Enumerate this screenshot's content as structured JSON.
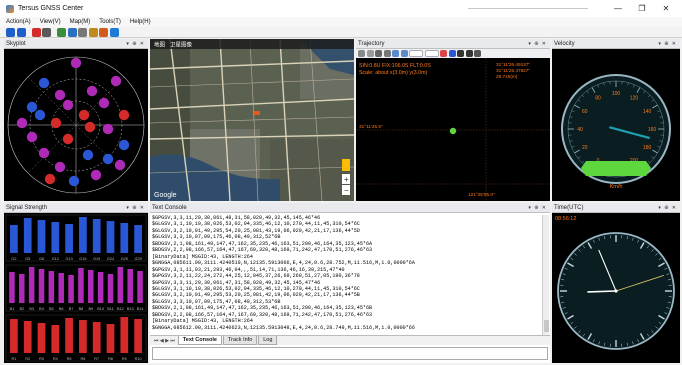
{
  "window": {
    "title": "Tersus GNSS Center",
    "controls": {
      "minimize": "—",
      "maximize": "❐",
      "close": "✕"
    }
  },
  "menu": [
    {
      "label": "Action(A)"
    },
    {
      "label": "View(V)"
    },
    {
      "label": "Map(M)"
    },
    {
      "label": "Tools(T)"
    },
    {
      "label": "Help(H)"
    }
  ],
  "toolbar_icons": [
    {
      "name": "connect-icon",
      "color": "#1f5fc9"
    },
    {
      "name": "disconnect-icon",
      "color": "#1f5fc9"
    },
    {
      "name": "record-icon",
      "color": "#d42a2a"
    },
    {
      "name": "stop-icon",
      "color": "#5a5a5a"
    },
    {
      "name": "open-file-icon",
      "color": "#3a8d3a"
    },
    {
      "name": "save-icon",
      "color": "#2a6fc0"
    },
    {
      "name": "settings-icon",
      "color": "#777777"
    },
    {
      "name": "config-icon",
      "color": "#c08a1e"
    },
    {
      "name": "upgrade-icon",
      "color": "#d45a1e"
    },
    {
      "name": "help-icon",
      "color": "#1e7ad4"
    }
  ],
  "panels": {
    "skyplot": {
      "title": "Skyplot",
      "controls": "▾ ⊕ ✕"
    },
    "map": {
      "tabs": [
        "地图",
        "卫星图像"
      ],
      "google_label": "Google",
      "zoom_in": "+",
      "zoom_out": "−"
    },
    "trajectory": {
      "title": "Trajectory",
      "controls": "▾ ⊕ ✕",
      "status_line1": "SIN:0.8U FIX:106.0S FLT:0.0S",
      "status_line2": "Scale: about x(3.0m) y(3.0m)",
      "coord_top1": "31°11'26.49137\"",
      "coord_top2": "31°11'26.47827\"",
      "coord_top3": "28.745(m)",
      "coord_left": "31°11'26.5\"",
      "coord_bottom": "121°25'05.0\""
    },
    "velocity": {
      "title": "Velocity",
      "controls": "▾ ⊕ ✕",
      "ticks": [
        "0",
        "20",
        "40",
        "60",
        "80",
        "100",
        "120",
        "140",
        "160",
        "180",
        "200"
      ],
      "display_value": "",
      "unit_label": "Km/h"
    },
    "signal": {
      "title": "Signal Strength",
      "controls": "▾ ⊕ ✕",
      "groups": [
        {
          "system": "GPS",
          "color": "#2a57d6",
          "labels": [
            "G2",
            "G5",
            "G6",
            "G12",
            "G13",
            "G15",
            "G19",
            "G24",
            "G25",
            "G29"
          ]
        },
        {
          "system": "BDS",
          "color": "#b02ab8",
          "labels": [
            "B1",
            "B2",
            "B3",
            "B4",
            "B5",
            "B6",
            "B7",
            "B8",
            "B9",
            "B10",
            "B11",
            "B12",
            "B13",
            "B14"
          ]
        },
        {
          "system": "GLO",
          "color": "#d42a2a",
          "labels": [
            "R1",
            "R2",
            "R3",
            "R4",
            "R5",
            "R6",
            "R7",
            "R8",
            "R9",
            "R10"
          ]
        }
      ]
    },
    "console": {
      "title": "Text Console",
      "controls": "▾ ⊕ ✕",
      "lines": [
        "$GPGSV,3,3,11,29,30,061,48,31,58,020,49,32,45,145,46*46",
        "$GLGSV,3,1,10,10,38,026,53,02,04,335,46,12,10,270,44,11,45,310,54*6C",
        "$GLGSV,3,2,10,01,49,295,54,20,25,081,43,19,06,029,42,21,17,136,44*5D",
        "$GLGSV,3,3,10,07,09,175,46,08,49,312,52*6B",
        "$BDGSV,2,1,08,161,49,147,47,162,35,235,46,163,51,200,46,164,35,123,45*6A",
        "$BDGSV,2,2,08,166,57,164,47,167,69,320,48,169,71,242,47,170,51,276,46*63",
        "[BinaryData] MSGID:43, LENGTH:264",
        "$GNGGA,085611.00,3111.4240519,N,12135.5913066,E,4,24,0.6,28.752,M,11.516,M,1.0,0000*6A",
        "$GPGSV,3,1,11,03,21,293,46,04,,,51,14,71,136,46,16,39,215,47*40",
        "$GPGSV,3,2,11,22,24,272,44,25,12,045,37,26,69,269,51,27,05,190,36*78",
        "$GPGSV,3,3,11,29,30,061,47,31,58,020,49,32,45,145,47*46",
        "$GLGSV,3,1,10,10,38,026,53,02,04,335,46,12,10,270,44,11,45,310,54*6C",
        "$GLGSV,3,2,10,01,49,295,53,20,25,081,42,19,06,029,42,21,17,136,44*5B",
        "$GLGSV,3,3,10,07,09,175,47,08,49,312,53*6B",
        "$BDGSV,2,1,08,161,49,147,47,162,35,235,46,163,51,200,46,164,35,123,45*6B",
        "$BDGSV,2,2,08,166,57,164,47,167,69,320,48,169,71,242,47,170,51,276,46*63",
        "[BinaryData] MSGID:43, LENGTH:264",
        "$GNGGA,085612.00,3111.4240623,N,12135.5913048,E,4,24,0.6,28.749,M,11.516,M,1.0,0000*66"
      ],
      "tabs": [
        "Text Console",
        "Track Info",
        "Log"
      ],
      "nav": "⏮ ◀ ▶ ⏭"
    },
    "time": {
      "title": "Time(UTC)",
      "controls": "▾ ⊕ ✕",
      "clock_text": "08:56:12",
      "time": {
        "hour": 8,
        "minute": 56,
        "second": 12
      }
    }
  },
  "colors": {
    "gps": "#2a57d6",
    "bds": "#b02ab8",
    "glo": "#d42a2a",
    "map_water": "#2f4d6b",
    "accent_green": "#5ed63e",
    "gauge_needle": "#1ea0b0",
    "orange_text": "#ff7a1a"
  }
}
